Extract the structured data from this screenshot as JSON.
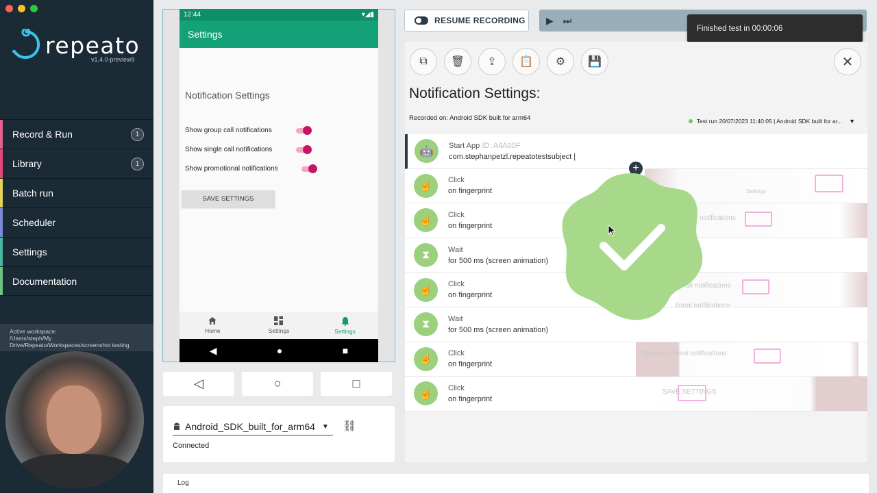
{
  "sidebar": {
    "logo": "repeato",
    "version": "v1.4.0-preview9",
    "nav": [
      {
        "label": "Record & Run",
        "badge": "1",
        "color": "#e8628f"
      },
      {
        "label": "Library",
        "badge": "1",
        "color": "#e5477a"
      },
      {
        "label": "Batch run",
        "badge": "",
        "color": "#e4d35a"
      },
      {
        "label": "Scheduler",
        "badge": "",
        "color": "#7a8ad6"
      },
      {
        "label": "Settings",
        "badge": "",
        "color": "#48b8a0"
      },
      {
        "label": "Documentation",
        "badge": "",
        "color": "#6ec47f"
      }
    ],
    "workspace_label": "Active workspace:",
    "workspace_path": "/Users/steph/My Drive/Repeato/Workspaces/screenshot testing"
  },
  "phone": {
    "time": "12:44",
    "appbar_title": "Settings",
    "screen_title": "Notification Settings",
    "rows": [
      "Show group call notifications",
      "Show single call notifications",
      "Show promotional notifications"
    ],
    "save_button": "SAVE SETTINGS",
    "bottom_nav": [
      {
        "label": "Home",
        "icon": "home-icon"
      },
      {
        "label": "Settings",
        "icon": "grid-icon"
      },
      {
        "label": "Settings",
        "icon": "bell-icon"
      }
    ]
  },
  "device": {
    "name": "Android_SDK_built_for_arm64",
    "status": "Connected"
  },
  "log_label": "Log",
  "toolbar": {
    "resume_label": "RESUME RECORDING"
  },
  "toast": "Finished test in 00:00:06",
  "test": {
    "title": "Notification Settings:",
    "recorded_on": "Recorded on: Android SDK built for arm64",
    "test_run": "Test run 20/07/2023 11:40:05 | Android SDK built for ar...",
    "steps": [
      {
        "title": "Start App",
        "id": "ID: A4A00F",
        "detail": "com.stephanpetzl.repeatotestsubject |",
        "icon": "android-icon"
      },
      {
        "title": "Click",
        "detail": "on fingerprint",
        "icon": "tap-icon"
      },
      {
        "title": "Click",
        "detail": "on fingerprint",
        "icon": "tap-icon"
      },
      {
        "title": "Wait",
        "detail": "for 500 ms (screen animation)",
        "icon": "hourglass-icon"
      },
      {
        "title": "Click",
        "detail": "on fingerprint",
        "icon": "tap-icon"
      },
      {
        "title": "Wait",
        "detail": "for 500 ms (screen animation)",
        "icon": "hourglass-icon"
      },
      {
        "title": "Click",
        "detail": "on fingerprint",
        "icon": "tap-icon"
      },
      {
        "title": "Click",
        "detail": "on fingerprint",
        "icon": "tap-icon"
      }
    ],
    "thumb_texts": [
      "Settings",
      "notifications",
      "ail notifications",
      "tional notifications",
      "Show pr otional notifications",
      "SAVE SETTINGS"
    ]
  },
  "colors": {
    "success": "#a8d98a",
    "accent": "#14a178",
    "toggle": "#c81464"
  }
}
